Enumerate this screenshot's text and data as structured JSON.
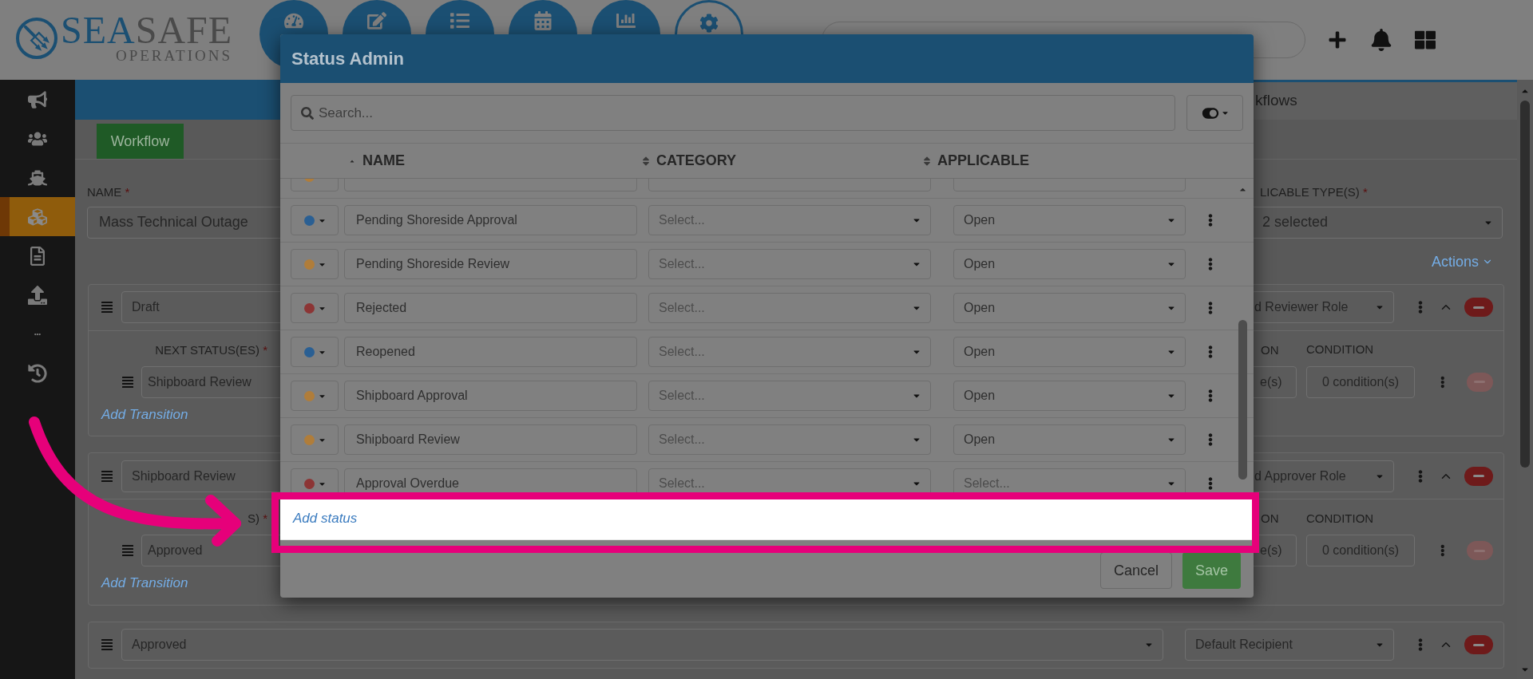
{
  "header": {
    "logo": {
      "primary": "SEA",
      "secondary": "SAFE",
      "tagline": "OPERATIONS"
    }
  },
  "sidebar": {
    "items": [
      {
        "selected": false
      },
      {
        "selected": false
      },
      {
        "selected": false
      },
      {
        "selected": true
      },
      {
        "selected": false
      },
      {
        "selected": false
      },
      {
        "selected": false
      },
      {
        "selected": false
      }
    ]
  },
  "breadcrumb": "kflows",
  "tabs": [
    {
      "label": "Workflow",
      "selected": true
    }
  ],
  "form": {
    "name_label": {
      "text": "NAME",
      "mark": "*"
    },
    "name_value": "Mass Technical Outage",
    "types_label": {
      "text": "LICABLE TYPE(S)",
      "mark": "*"
    },
    "types_value": "2 selected"
  },
  "actions_link": "Actions",
  "steps": [
    {
      "status": "Draft",
      "role": "d Reviewer Role",
      "transitions_label": {
        "text": "NEXT STATUS(ES)",
        "mark": "*"
      },
      "action_label": "ON",
      "condition_label": "CONDITION",
      "transitions": [
        {
          "status": "Shipboard Review",
          "action": "e(s)",
          "condition": "0 condition(s)",
          "remove_disabled": true
        }
      ],
      "add_link": "Add Transition"
    },
    {
      "status": "Shipboard Review",
      "role": "d Approver Role",
      "transitions_label": {
        "text": "S)",
        "mark": "*"
      },
      "action_label": "ON",
      "condition_label": "CONDITION",
      "transitions": [
        {
          "status": "Approved",
          "action": "e(s)",
          "condition": "0 condition(s)",
          "remove_disabled": true
        }
      ],
      "add_link": "Add Transition"
    },
    {
      "status": "Approved",
      "role": "Default Recipient"
    }
  ],
  "modal": {
    "title": "Status Admin",
    "search": {
      "placeholder": "Search..."
    },
    "columns": [
      {
        "label": "NAME",
        "sorted": true
      },
      {
        "label": "CATEGORY",
        "sorted": false
      },
      {
        "label": "APPLICABLE",
        "sorted": false
      }
    ],
    "rows": [
      {
        "color": "#b07d3a"
      },
      {
        "color": "#2a5f93",
        "name": "Pending Shoreside Approval",
        "category": {
          "placeholder": "Select..."
        },
        "applicable": {
          "value": "Open"
        }
      },
      {
        "color": "#b07d3a",
        "name": "Pending Shoreside Review",
        "category": {
          "placeholder": "Select..."
        },
        "applicable": {
          "value": "Open"
        }
      },
      {
        "color": "#8c3535",
        "name": "Rejected",
        "category": {
          "placeholder": "Select..."
        },
        "applicable": {
          "value": "Open"
        }
      },
      {
        "color": "#2a5f93",
        "name": "Reopened",
        "category": {
          "placeholder": "Select..."
        },
        "applicable": {
          "value": "Open"
        }
      },
      {
        "color": "#b07d3a",
        "name": "Shipboard Approval",
        "category": {
          "placeholder": "Select..."
        },
        "applicable": {
          "value": "Open"
        }
      },
      {
        "color": "#b07d3a",
        "name": "Shipboard Review",
        "category": {
          "placeholder": "Select..."
        },
        "applicable": {
          "value": "Open"
        }
      },
      {
        "color": "#8c3535",
        "name": "Approval Overdue",
        "category": {
          "placeholder": "Select..."
        },
        "applicable": {
          "placeholder": "Select..."
        }
      }
    ],
    "add_link": "Add status",
    "buttons": [
      {
        "label": "Cancel",
        "kind": "secondary"
      },
      {
        "label": "Save",
        "kind": "primary"
      }
    ]
  }
}
